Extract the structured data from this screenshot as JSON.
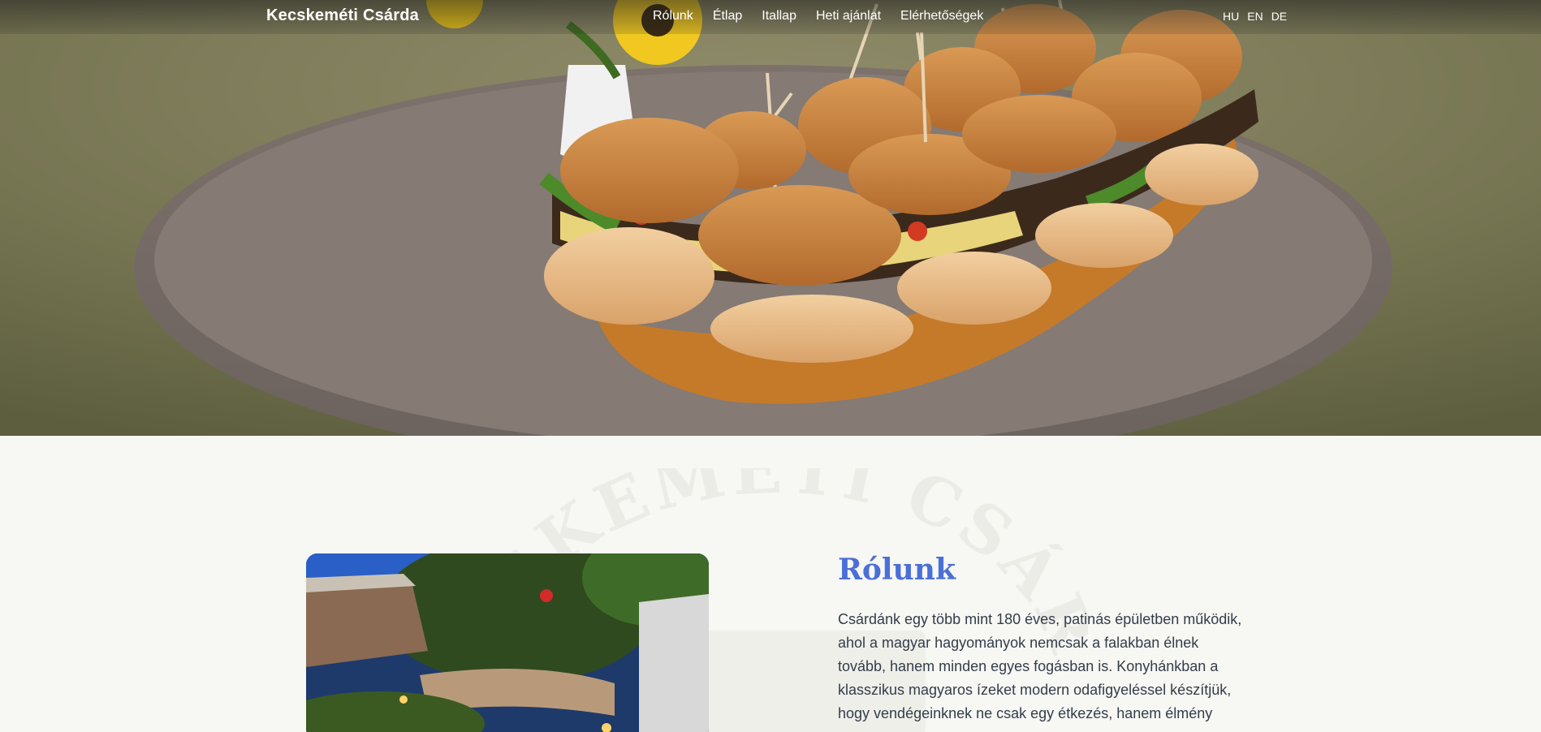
{
  "brand": "Kecskeméti Csárda",
  "nav": [
    "Rólunk",
    "Étlap",
    "Itallap",
    "Heti ajánlat",
    "Elérhetőségek"
  ],
  "languages": [
    "HU",
    "EN",
    "DE"
  ],
  "about": {
    "title": "Rólunk",
    "text": "Csárdánk egy több mint 180 éves, patinás épületben működik, ahol a magyar hagyományok nemcsak a falakban élnek tovább, hanem minden egyes fogásban is. Konyhánkban a klasszikus magyaros ízeket modern odafigyeléssel készítjük, hogy vendégeinknek ne csak egy étkezés, hanem élmény",
    "watermark": "KECSKEMÉTI CSÁRDA"
  },
  "colors": {
    "accent": "#4a6fd8",
    "text": "#333d4a",
    "background": "#f7f7f3"
  }
}
